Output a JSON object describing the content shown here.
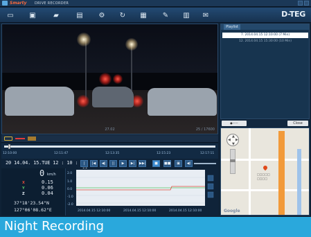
{
  "app": {
    "brand": "Smarty",
    "product": "DRIVE RECORDER",
    "company": "D-TEG"
  },
  "toolbar": {
    "tools": [
      {
        "icon": "window-icon"
      },
      {
        "icon": "camera-icon"
      },
      {
        "icon": "folder-icon"
      },
      {
        "icon": "image-icon"
      },
      {
        "icon": "gear-icon"
      },
      {
        "icon": "refresh-icon"
      },
      {
        "icon": "calendar-icon"
      },
      {
        "icon": "wrench-icon"
      },
      {
        "icon": "export-icon"
      },
      {
        "icon": "chat-icon"
      }
    ]
  },
  "video": {
    "center_overlay": "27.02",
    "right_overlay": "25 / 17600"
  },
  "file_panel": {
    "tab": "Playlist",
    "rows": [
      {
        "text": "7. 2014.04.15 12:10:00 (7 Min)",
        "selected": true
      },
      {
        "text": "12. 2014.04.15 15:30:00 (10 Min)",
        "selected": false
      }
    ],
    "left_button": "●——",
    "right_button": "Close"
  },
  "timeline": {
    "labels": [
      "12:10:00",
      "12:11:47",
      "12:13:35",
      "12:15:23",
      "12:17:11"
    ]
  },
  "controls": {
    "datetime": "20 14.04. 15.TUE  12 : 10 : 00",
    "buttons": [
      "|◀◀",
      "|◀",
      "◀|",
      "||",
      "▶",
      "▶|",
      "▶▶|",
      "■",
      "■■",
      "▣",
      "◀)"
    ]
  },
  "info": {
    "speed": "0",
    "speed_unit": "km/h",
    "axes": [
      {
        "label": "X",
        "value": "0.15",
        "color": "#e04a3a"
      },
      {
        "label": "Y",
        "value": "0.06",
        "color": "#5ac76a"
      },
      {
        "label": "Z",
        "value": "0.04",
        "color": "#e6eef6"
      }
    ],
    "lat": "37°18'23.54\"N",
    "lon": "127°06'08.62\"E"
  },
  "graph": {
    "y_ticks": [
      "2.0",
      "1.0",
      "0.0",
      "-1.0",
      "-2.0"
    ],
    "x_labels": [
      "2014.04.15 12:10:00",
      "2014.04.15 12:10:00",
      "2014.04.15 12:10:00"
    ]
  },
  "caption": {
    "text": "Night Recording"
  }
}
